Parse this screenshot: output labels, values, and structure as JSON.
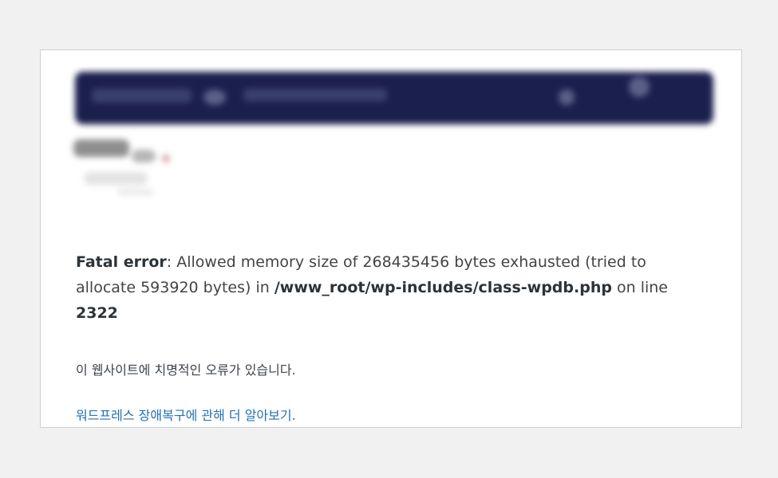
{
  "error": {
    "label": "Fatal error",
    "message_before": ": Allowed memory size of 268435456 bytes exhausted (tried to allocate 593920 bytes) in ",
    "file": "/www_root/wp-includes/class-wpdb.php",
    "message_middle": " on line ",
    "line": "2322"
  },
  "notice": {
    "text": "이 웹사이트에 치명적인 오류가 있습니다."
  },
  "help": {
    "link_text": "워드프레스 장애복구에 관해 더 알아보기."
  },
  "colors": {
    "page_background": "#f1f1f1",
    "card_background": "#ffffff",
    "link": "#2271b1",
    "blurred_header": "#1b1f4d"
  }
}
